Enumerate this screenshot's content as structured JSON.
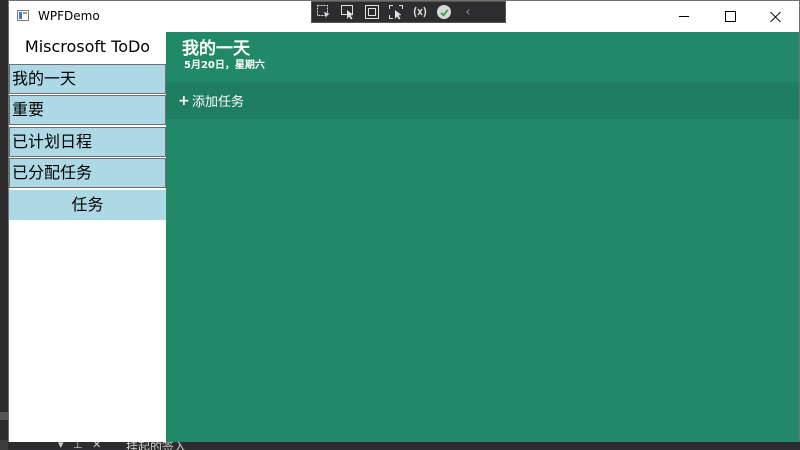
{
  "window": {
    "title": "WPFDemo"
  },
  "debug_toolbar": {
    "icons": [
      "select-element-icon",
      "pointer-icon",
      "adorner-box-icon",
      "track-focus-icon",
      "binding-failures-icon",
      "check-circle-icon",
      "collapse-chevron-icon"
    ]
  },
  "sidebar": {
    "title": "Miscrosoft ToDo",
    "items": [
      {
        "label": "我的一天"
      },
      {
        "label": "重要"
      },
      {
        "label": "已计划日程"
      },
      {
        "label": "已分配任务"
      },
      {
        "label": "任务"
      }
    ]
  },
  "main": {
    "title": "我的一天",
    "date": "5月20日，星期六",
    "add_task_symbol": "+",
    "add_task_label": "添加任务"
  },
  "background": {
    "cut_text": "挂起的签入"
  },
  "colors": {
    "accent_green": "#218868",
    "add_bar_green": "#1f7d60",
    "nav_blue": "#add8e6"
  }
}
